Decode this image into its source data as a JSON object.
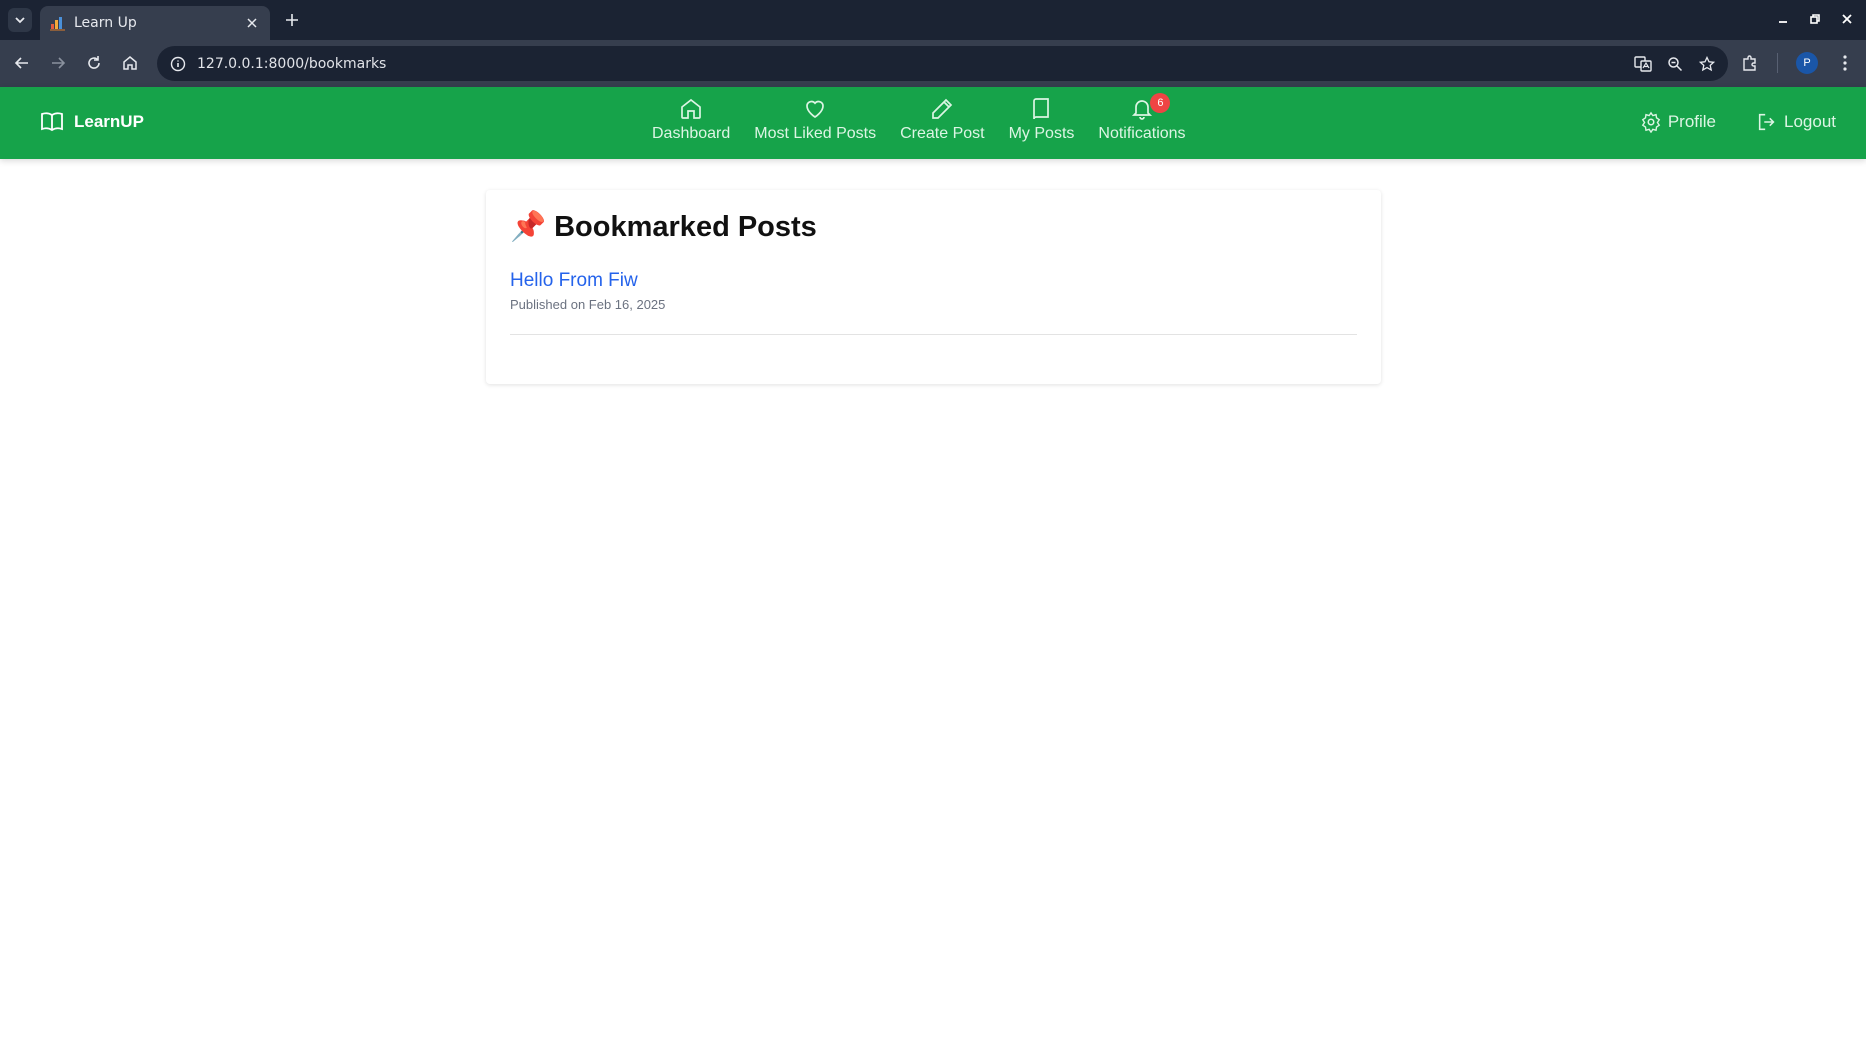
{
  "browser": {
    "tab_title": "Learn Up",
    "url": "127.0.0.1:8000/bookmarks",
    "profile_initial": "P"
  },
  "app": {
    "brand": "LearnUP",
    "nav": [
      {
        "label": "Dashboard",
        "icon": "home-icon"
      },
      {
        "label": "Most Liked Posts",
        "icon": "heart-icon"
      },
      {
        "label": "Create Post",
        "icon": "pencil-icon"
      },
      {
        "label": "My Posts",
        "icon": "book-icon"
      },
      {
        "label": "Notifications",
        "icon": "bell-icon"
      }
    ],
    "notification_count": "6",
    "right_nav": [
      {
        "label": "Profile",
        "icon": "gear-icon"
      },
      {
        "label": "Logout",
        "icon": "logout-icon"
      }
    ]
  },
  "page": {
    "title": "Bookmarked Posts",
    "title_emoji": "📌",
    "posts": [
      {
        "title": "Hello From Fiw",
        "published": "Published on Feb 16, 2025"
      }
    ]
  },
  "colors": {
    "navbar": "#16a34a",
    "link": "#2563eb",
    "badge": "#ef4444"
  }
}
